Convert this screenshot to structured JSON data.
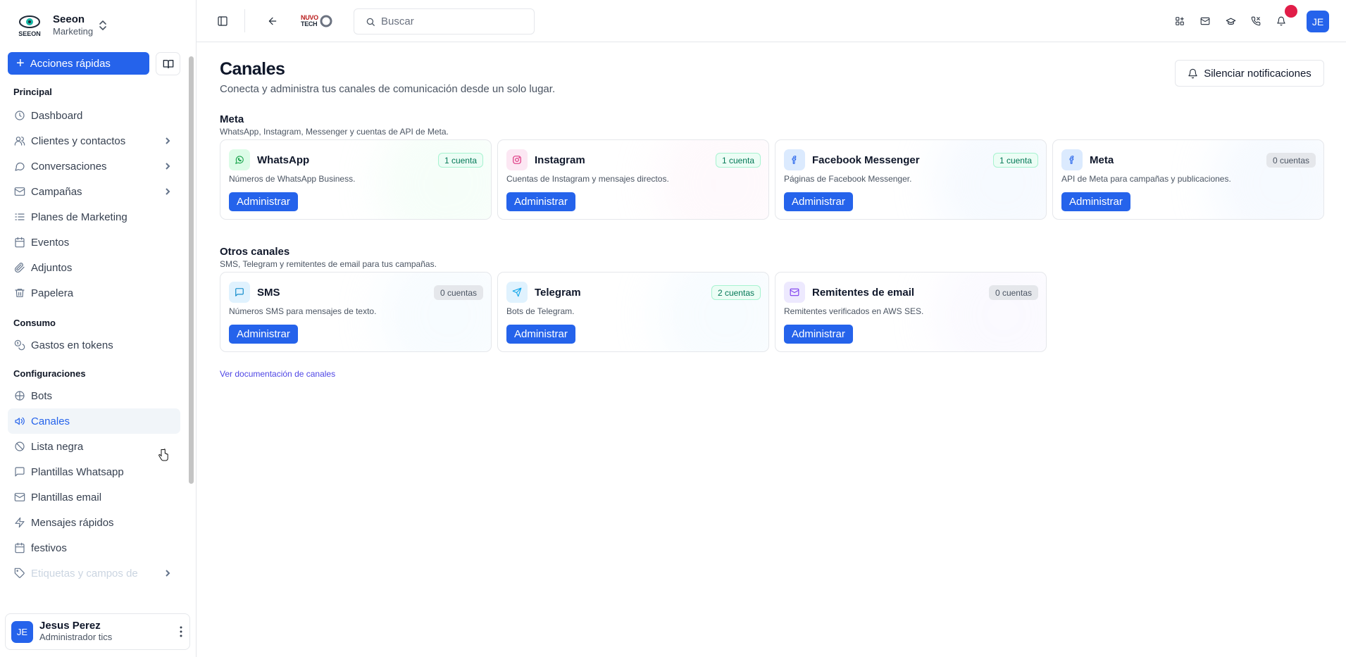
{
  "sidebar": {
    "brand_name": "Seeon",
    "brand_sub": "Marketing",
    "logo_text": "SEEON",
    "quick_actions": "Acciones rápidas",
    "sections": [
      {
        "title": "Principal",
        "items": [
          {
            "label": "Dashboard",
            "icon": "clock-icon",
            "chevron": false
          },
          {
            "label": "Clientes y contactos",
            "icon": "users-icon",
            "chevron": true
          },
          {
            "label": "Conversaciones",
            "icon": "chat-icon",
            "chevron": true
          },
          {
            "label": "Campañas",
            "icon": "mail-icon",
            "chevron": true
          },
          {
            "label": "Planes de Marketing",
            "icon": "list-icon",
            "chevron": false
          },
          {
            "label": "Eventos",
            "icon": "calendar-icon",
            "chevron": false
          },
          {
            "label": "Adjuntos",
            "icon": "paperclip-icon",
            "chevron": false
          },
          {
            "label": "Papelera",
            "icon": "trash-icon",
            "chevron": false
          }
        ]
      },
      {
        "title": "Consumo",
        "items": [
          {
            "label": "Gastos en tokens",
            "icon": "coins-icon",
            "chevron": false
          }
        ]
      },
      {
        "title": "Configuraciones",
        "items": [
          {
            "label": "Bots",
            "icon": "bot-icon",
            "chevron": false
          },
          {
            "label": "Canales",
            "icon": "megaphone-icon",
            "chevron": false,
            "active": true
          },
          {
            "label": "Lista negra",
            "icon": "ban-icon",
            "chevron": false
          },
          {
            "label": "Plantillas Whatsapp",
            "icon": "message-square-icon",
            "chevron": false
          },
          {
            "label": "Plantillas email",
            "icon": "mail-icon",
            "chevron": false
          },
          {
            "label": "Mensajes rápidos",
            "icon": "zap-icon",
            "chevron": false
          },
          {
            "label": "festivos",
            "icon": "calendar-icon",
            "chevron": false
          },
          {
            "label": "Etiquetas y campos de",
            "icon": "tag-icon",
            "chevron": true,
            "faded": true
          }
        ]
      }
    ],
    "user": {
      "initials": "JE",
      "name": "Jesus Perez",
      "role": "Administrador tics"
    }
  },
  "topbar": {
    "search_placeholder": "Buscar",
    "brand_logo_line1": "NUVO",
    "brand_logo_line2": "TECH",
    "avatar_initials": "JE",
    "icons": [
      "sidebar-toggle-icon",
      "back-arrow-icon",
      "apps-icon",
      "mail-icon",
      "graduation-cap-icon",
      "phone-icon",
      "bell-icon"
    ]
  },
  "main": {
    "title": "Canales",
    "subtitle": "Conecta y administra tus canales de comunicación desde un solo lugar.",
    "mute_label": "Silenciar notificaciones",
    "groups": [
      {
        "title": "Meta",
        "subtitle": "WhatsApp, Instagram, Messenger y cuentas de API de Meta.",
        "cards": [
          {
            "name": "WhatsApp",
            "badge": "1 cuenta",
            "badge_tone": "green",
            "desc": "Números de WhatsApp Business.",
            "action": "Administrar",
            "icon": "whatsapp-icon",
            "accent": "#16a34a",
            "tint": "#dcfce7"
          },
          {
            "name": "Instagram",
            "badge": "1 cuenta",
            "badge_tone": "green",
            "desc": "Cuentas de Instagram y mensajes directos.",
            "action": "Administrar",
            "icon": "instagram-icon",
            "accent": "#db2777",
            "tint": "#fce7f3"
          },
          {
            "name": "Facebook Messenger",
            "badge": "1 cuenta",
            "badge_tone": "green",
            "desc": "Páginas de Facebook Messenger.",
            "action": "Administrar",
            "icon": "facebook-icon",
            "accent": "#2563eb",
            "tint": "#dbeafe"
          },
          {
            "name": "Meta",
            "badge": "0 cuentas",
            "badge_tone": "gray",
            "desc": "API de Meta para campañas y publicaciones.",
            "action": "Administrar",
            "icon": "facebook-icon",
            "accent": "#2563eb",
            "tint": "#dbeafe"
          }
        ]
      },
      {
        "title": "Otros canales",
        "subtitle": "SMS, Telegram y remitentes de email para tus campañas.",
        "cards": [
          {
            "name": "SMS",
            "badge": "0 cuentas",
            "badge_tone": "gray",
            "desc": "Números SMS para mensajes de texto.",
            "action": "Administrar",
            "icon": "message-square-icon",
            "accent": "#0284c7",
            "tint": "#e0f2fe"
          },
          {
            "name": "Telegram",
            "badge": "2 cuentas",
            "badge_tone": "green",
            "desc": "Bots de Telegram.",
            "action": "Administrar",
            "icon": "send-icon",
            "accent": "#0ea5e9",
            "tint": "#e0f2fe"
          },
          {
            "name": "Remitentes de email",
            "badge": "0 cuentas",
            "badge_tone": "gray",
            "desc": "Remitentes verificados en AWS SES.",
            "action": "Administrar",
            "icon": "mail-icon",
            "accent": "#7c3aed",
            "tint": "#ede9fe"
          }
        ]
      }
    ],
    "docs_link": "Ver documentación de canales"
  }
}
